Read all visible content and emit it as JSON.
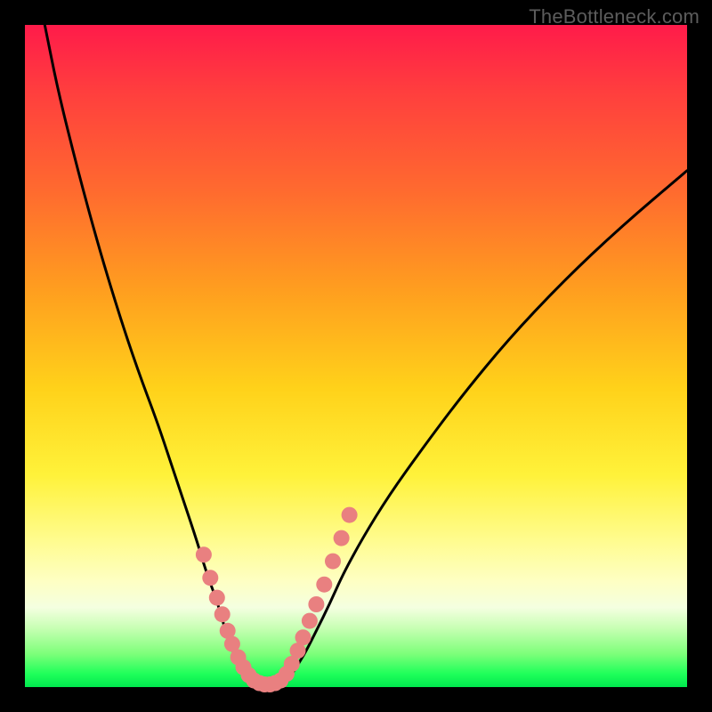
{
  "watermark": "TheBottleneck.com",
  "chart_data": {
    "type": "line",
    "title": "",
    "xlabel": "",
    "ylabel": "",
    "xlim": [
      0,
      100
    ],
    "ylim": [
      0,
      100
    ],
    "grid": false,
    "legend": false,
    "background_gradient_stops": [
      {
        "pos": 0,
        "color": "#ff1b4a"
      },
      {
        "pos": 25,
        "color": "#ff6a2f"
      },
      {
        "pos": 55,
        "color": "#ffd21a"
      },
      {
        "pos": 85,
        "color": "#feffc3"
      },
      {
        "pos": 100,
        "color": "#00e84e"
      }
    ],
    "annotations": [
      {
        "text": "TheBottleneck.com",
        "position": "top-right"
      }
    ],
    "series": [
      {
        "name": "left-branch",
        "x": [
          3,
          5,
          8,
          11,
          14,
          17,
          20,
          22,
          24,
          26,
          27.5,
          29,
          30,
          31,
          32,
          33,
          33.5,
          34
        ],
        "y": [
          100,
          90,
          78,
          67,
          57,
          48,
          40,
          34,
          28,
          22,
          17,
          13,
          9.5,
          6.5,
          4,
          2.2,
          1.2,
          0.6
        ]
      },
      {
        "name": "valley-floor",
        "x": [
          34,
          35,
          36,
          37,
          38,
          39
        ],
        "y": [
          0.6,
          0.3,
          0.2,
          0.2,
          0.3,
          0.6
        ]
      },
      {
        "name": "right-branch",
        "x": [
          39,
          40,
          41,
          42.5,
          44,
          46,
          48,
          51,
          55,
          60,
          66,
          73,
          81,
          90,
          100
        ],
        "y": [
          0.6,
          1.5,
          3,
          5.5,
          8.5,
          12.5,
          17,
          22.5,
          29,
          36,
          44,
          52.5,
          61,
          69.5,
          78
        ]
      }
    ],
    "highlight_points": {
      "name": "beads",
      "comment": "pink dots along lower portion of V and valley",
      "points": [
        {
          "x": 27.0,
          "y": 20
        },
        {
          "x": 28.0,
          "y": 16.5
        },
        {
          "x": 29.0,
          "y": 13.5
        },
        {
          "x": 29.8,
          "y": 11
        },
        {
          "x": 30.6,
          "y": 8.5
        },
        {
          "x": 31.3,
          "y": 6.5
        },
        {
          "x": 32.2,
          "y": 4.5
        },
        {
          "x": 33.0,
          "y": 3
        },
        {
          "x": 33.8,
          "y": 1.8
        },
        {
          "x": 34.6,
          "y": 1.0
        },
        {
          "x": 35.4,
          "y": 0.6
        },
        {
          "x": 36.2,
          "y": 0.4
        },
        {
          "x": 37.0,
          "y": 0.4
        },
        {
          "x": 37.8,
          "y": 0.6
        },
        {
          "x": 38.6,
          "y": 1.0
        },
        {
          "x": 39.5,
          "y": 2
        },
        {
          "x": 40.3,
          "y": 3.5
        },
        {
          "x": 41.2,
          "y": 5.5
        },
        {
          "x": 42.0,
          "y": 7.5
        },
        {
          "x": 43.0,
          "y": 10
        },
        {
          "x": 44.0,
          "y": 12.5
        },
        {
          "x": 45.2,
          "y": 15.5
        },
        {
          "x": 46.5,
          "y": 19
        },
        {
          "x": 47.8,
          "y": 22.5
        },
        {
          "x": 49.0,
          "y": 26
        }
      ]
    }
  }
}
